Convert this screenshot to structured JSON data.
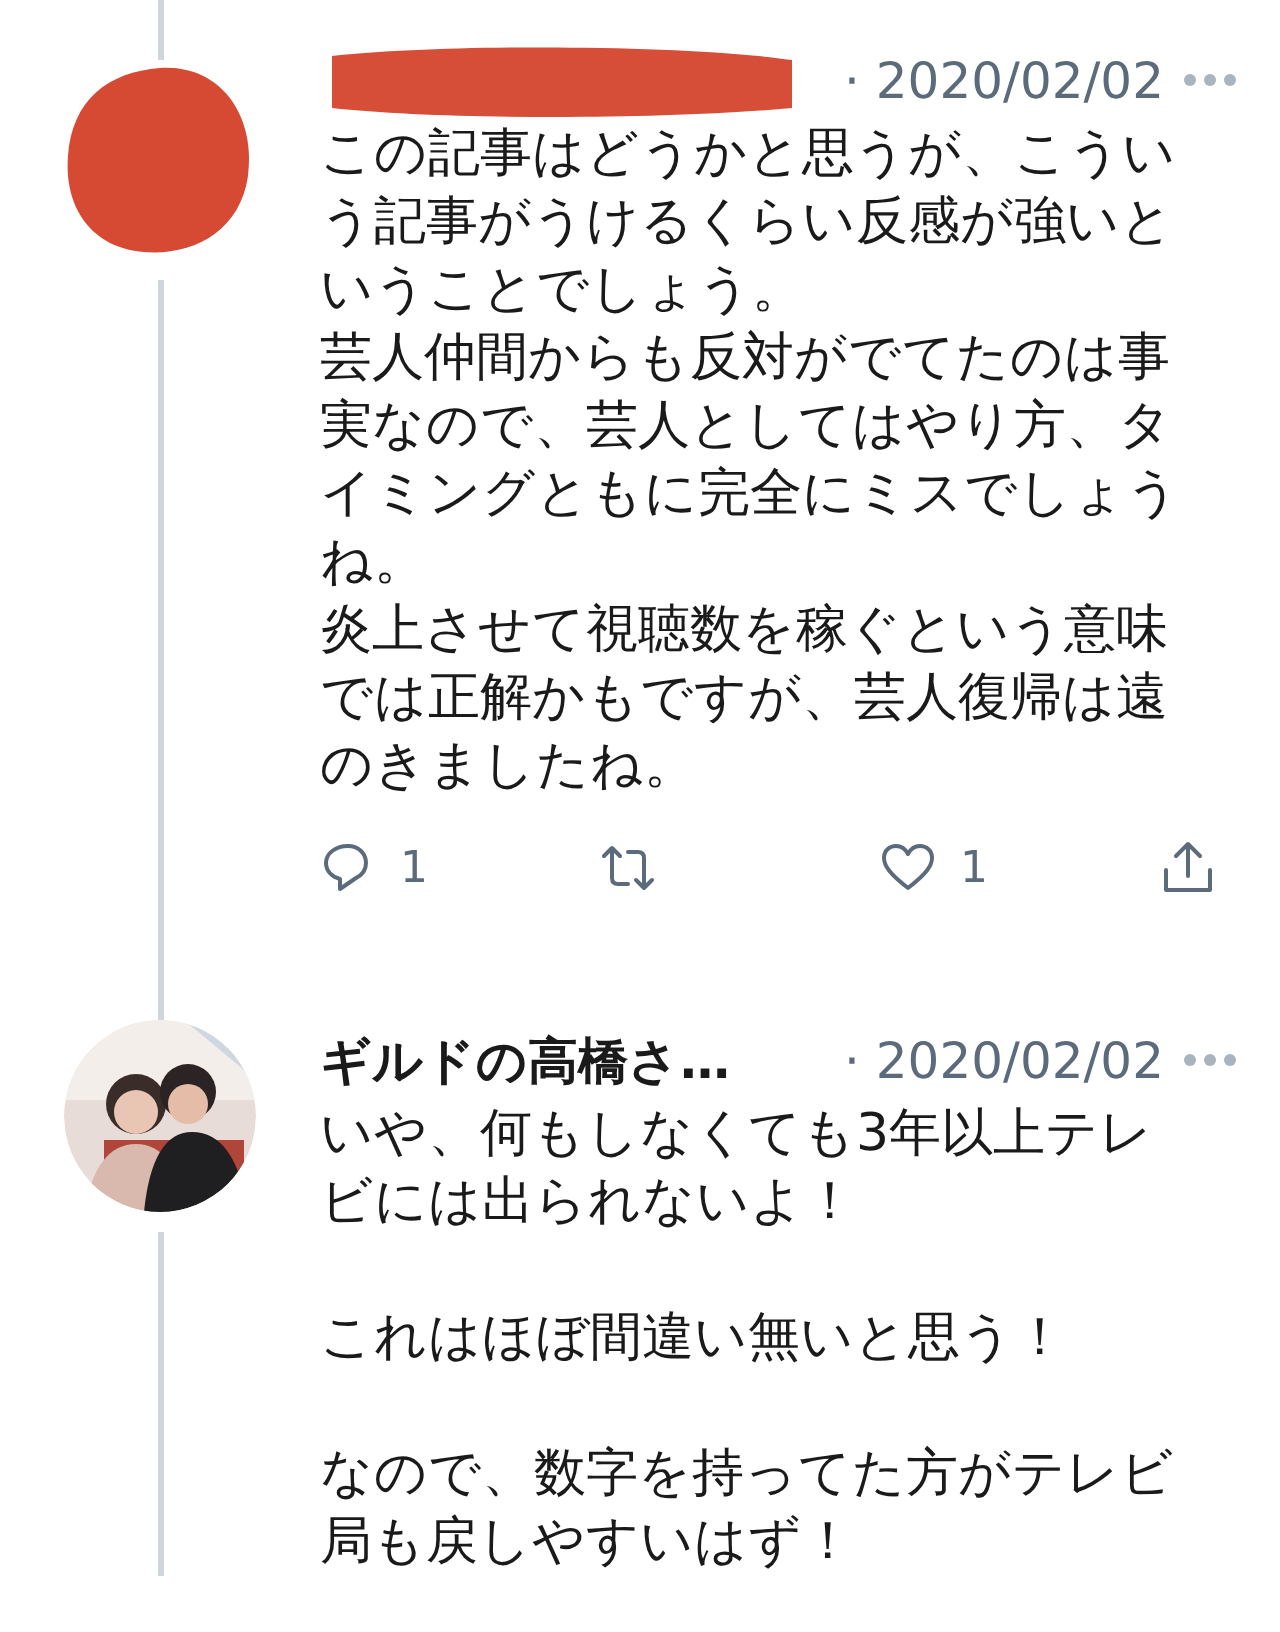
{
  "tweets": [
    {
      "author": {
        "kind": "redacted"
      },
      "date": "· 2020/02/02",
      "paragraphs": [
        {
          "lines": [
            "この記事はどうかと思うが、こういう記事がうけるくらい反感が強いということでしょう。",
            "芸人仲間からも反対がでてたのは事実なので、芸人としてはやり方、タイミングともに完全にミスでしょうね。",
            "炎上させて視聴数を稼ぐという意味では正解かもですが、芸人復帰は遠のきましたね。"
          ]
        }
      ],
      "actions": [
        {
          "kind": "reply",
          "count": "1"
        },
        {
          "kind": "retweet"
        },
        {
          "kind": "like",
          "count": "1"
        },
        {
          "kind": "share"
        }
      ]
    },
    {
      "author": {
        "kind": "user",
        "name": "ギルドの高橋さ…"
      },
      "date": "· 2020/02/02",
      "paragraphs": [
        {
          "lines": [
            "いや、何もしなくても3年以上テレビには出られないよ！"
          ]
        },
        {
          "lines": [
            "これはほぼ間違い無いと思う！"
          ]
        },
        {
          "lines": [
            "なので、数字を持ってた方がテレビ局も戻しやすいはず！"
          ]
        }
      ]
    }
  ]
}
